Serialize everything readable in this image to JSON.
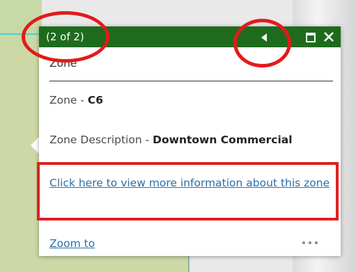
{
  "popup": {
    "counter": "(2 of 2)",
    "title_partial": "Zone",
    "zone_label": "Zone - ",
    "zone_value": "C6",
    "description_label": "Zone Description - ",
    "description_value": "Downtown Commercial",
    "more_info_link": "Click here to view more information about this zone",
    "zoom_link": "Zoom to"
  },
  "icons": {
    "previous": "triangle-left-icon",
    "maximize": "maximize-icon",
    "close": "close-icon",
    "more": "ellipsis-icon"
  },
  "colors": {
    "header_bg": "#1e6b1e",
    "link": "#2a6fa8",
    "annotation": "#e31a1a"
  }
}
